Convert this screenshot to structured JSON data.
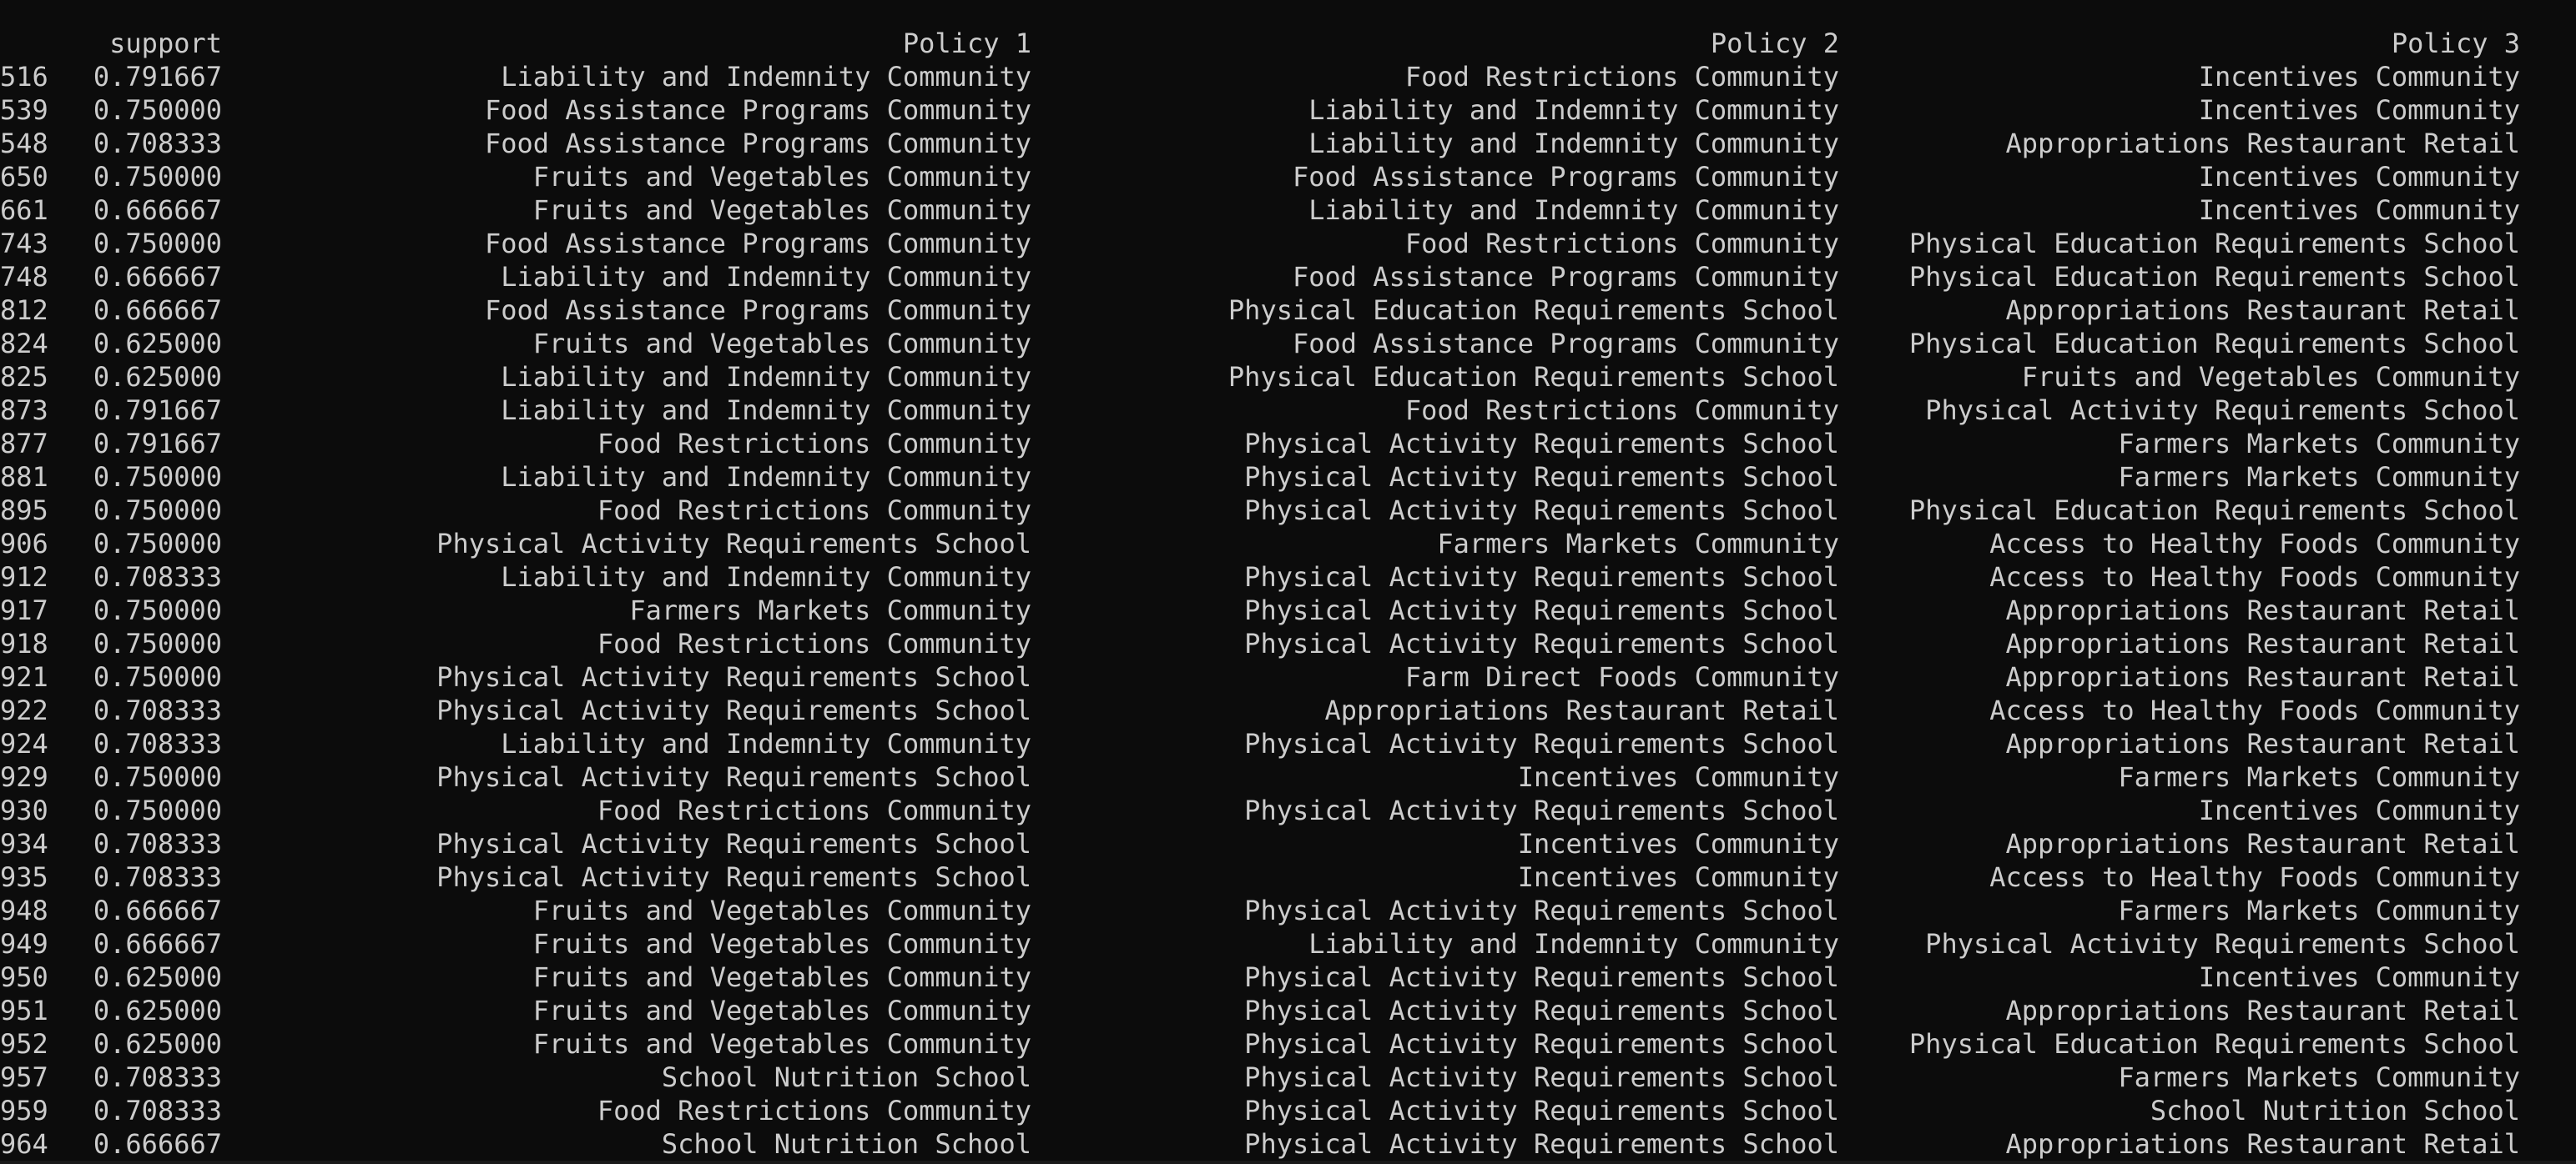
{
  "header": {
    "index": "",
    "support": "support",
    "policy1": "Policy 1",
    "policy2": "Policy 2",
    "policy3": "Policy 3"
  },
  "rows": [
    {
      "index": "516",
      "support": "0.791667",
      "policy1": "Liability and Indemnity Community",
      "policy2": "Food Restrictions Community",
      "policy3": "Incentives Community"
    },
    {
      "index": "539",
      "support": "0.750000",
      "policy1": "Food Assistance Programs Community",
      "policy2": "Liability and Indemnity Community",
      "policy3": "Incentives Community"
    },
    {
      "index": "548",
      "support": "0.708333",
      "policy1": "Food Assistance Programs Community",
      "policy2": "Liability and Indemnity Community",
      "policy3": "Appropriations Restaurant Retail"
    },
    {
      "index": "650",
      "support": "0.750000",
      "policy1": "Fruits and Vegetables Community",
      "policy2": "Food Assistance Programs Community",
      "policy3": "Incentives Community"
    },
    {
      "index": "661",
      "support": "0.666667",
      "policy1": "Fruits and Vegetables Community",
      "policy2": "Liability and Indemnity Community",
      "policy3": "Incentives Community"
    },
    {
      "index": "743",
      "support": "0.750000",
      "policy1": "Food Assistance Programs Community",
      "policy2": "Food Restrictions Community",
      "policy3": "Physical Education Requirements School"
    },
    {
      "index": "748",
      "support": "0.666667",
      "policy1": "Liability and Indemnity Community",
      "policy2": "Food Assistance Programs Community",
      "policy3": "Physical Education Requirements School"
    },
    {
      "index": "812",
      "support": "0.666667",
      "policy1": "Food Assistance Programs Community",
      "policy2": "Physical Education Requirements School",
      "policy3": "Appropriations Restaurant Retail"
    },
    {
      "index": "824",
      "support": "0.625000",
      "policy1": "Fruits and Vegetables Community",
      "policy2": "Food Assistance Programs Community",
      "policy3": "Physical Education Requirements School"
    },
    {
      "index": "825",
      "support": "0.625000",
      "policy1": "Liability and Indemnity Community",
      "policy2": "Physical Education Requirements School",
      "policy3": "Fruits and Vegetables Community"
    },
    {
      "index": "873",
      "support": "0.791667",
      "policy1": "Liability and Indemnity Community",
      "policy2": "Food Restrictions Community",
      "policy3": "Physical Activity Requirements School"
    },
    {
      "index": "877",
      "support": "0.791667",
      "policy1": "Food Restrictions Community",
      "policy2": "Physical Activity Requirements School",
      "policy3": "Farmers Markets Community"
    },
    {
      "index": "881",
      "support": "0.750000",
      "policy1": "Liability and Indemnity Community",
      "policy2": "Physical Activity Requirements School",
      "policy3": "Farmers Markets Community"
    },
    {
      "index": "895",
      "support": "0.750000",
      "policy1": "Food Restrictions Community",
      "policy2": "Physical Activity Requirements School",
      "policy3": "Physical Education Requirements School"
    },
    {
      "index": "906",
      "support": "0.750000",
      "policy1": "Physical Activity Requirements School",
      "policy2": "Farmers Markets Community",
      "policy3": "Access to Healthy Foods Community"
    },
    {
      "index": "912",
      "support": "0.708333",
      "policy1": "Liability and Indemnity Community",
      "policy2": "Physical Activity Requirements School",
      "policy3": "Access to Healthy Foods Community"
    },
    {
      "index": "917",
      "support": "0.750000",
      "policy1": "Farmers Markets Community",
      "policy2": "Physical Activity Requirements School",
      "policy3": "Appropriations Restaurant Retail"
    },
    {
      "index": "918",
      "support": "0.750000",
      "policy1": "Food Restrictions Community",
      "policy2": "Physical Activity Requirements School",
      "policy3": "Appropriations Restaurant Retail"
    },
    {
      "index": "921",
      "support": "0.750000",
      "policy1": "Physical Activity Requirements School",
      "policy2": "Farm Direct Foods Community",
      "policy3": "Appropriations Restaurant Retail"
    },
    {
      "index": "922",
      "support": "0.708333",
      "policy1": "Physical Activity Requirements School",
      "policy2": "Appropriations Restaurant Retail",
      "policy3": "Access to Healthy Foods Community"
    },
    {
      "index": "924",
      "support": "0.708333",
      "policy1": "Liability and Indemnity Community",
      "policy2": "Physical Activity Requirements School",
      "policy3": "Appropriations Restaurant Retail"
    },
    {
      "index": "929",
      "support": "0.750000",
      "policy1": "Physical Activity Requirements School",
      "policy2": "Incentives Community",
      "policy3": "Farmers Markets Community"
    },
    {
      "index": "930",
      "support": "0.750000",
      "policy1": "Food Restrictions Community",
      "policy2": "Physical Activity Requirements School",
      "policy3": "Incentives Community"
    },
    {
      "index": "934",
      "support": "0.708333",
      "policy1": "Physical Activity Requirements School",
      "policy2": "Incentives Community",
      "policy3": "Appropriations Restaurant Retail"
    },
    {
      "index": "935",
      "support": "0.708333",
      "policy1": "Physical Activity Requirements School",
      "policy2": "Incentives Community",
      "policy3": "Access to Healthy Foods Community"
    },
    {
      "index": "948",
      "support": "0.666667",
      "policy1": "Fruits and Vegetables Community",
      "policy2": "Physical Activity Requirements School",
      "policy3": "Farmers Markets Community"
    },
    {
      "index": "949",
      "support": "0.666667",
      "policy1": "Fruits and Vegetables Community",
      "policy2": "Liability and Indemnity Community",
      "policy3": "Physical Activity Requirements School"
    },
    {
      "index": "950",
      "support": "0.625000",
      "policy1": "Fruits and Vegetables Community",
      "policy2": "Physical Activity Requirements School",
      "policy3": "Incentives Community"
    },
    {
      "index": "951",
      "support": "0.625000",
      "policy1": "Fruits and Vegetables Community",
      "policy2": "Physical Activity Requirements School",
      "policy3": "Appropriations Restaurant Retail"
    },
    {
      "index": "952",
      "support": "0.625000",
      "policy1": "Fruits and Vegetables Community",
      "policy2": "Physical Activity Requirements School",
      "policy3": "Physical Education Requirements School"
    },
    {
      "index": "957",
      "support": "0.708333",
      "policy1": "School Nutrition School",
      "policy2": "Physical Activity Requirements School",
      "policy3": "Farmers Markets Community"
    },
    {
      "index": "959",
      "support": "0.708333",
      "policy1": "Food Restrictions Community",
      "policy2": "Physical Activity Requirements School",
      "policy3": "School Nutrition School"
    },
    {
      "index": "964",
      "support": "0.666667",
      "policy1": "School Nutrition School",
      "policy2": "Physical Activity Requirements School",
      "policy3": "Appropriations Restaurant Retail"
    }
  ]
}
